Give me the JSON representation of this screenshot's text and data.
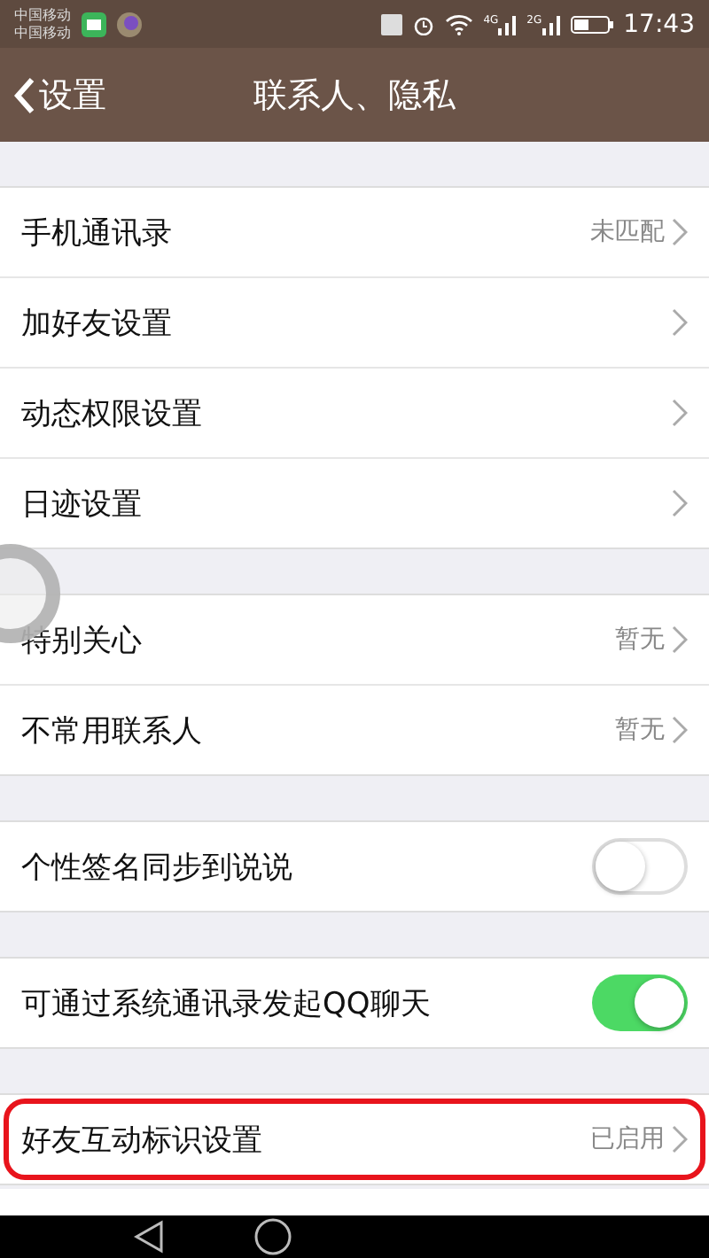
{
  "status_bar": {
    "carriers": [
      "中国移动",
      "中国移动"
    ],
    "time": "17:43",
    "network_labels": [
      "4G",
      "2G"
    ]
  },
  "header": {
    "back": "设置",
    "title": "联系人、隐私"
  },
  "groups": [
    {
      "rows": [
        {
          "kind": "value",
          "label": "手机通讯录",
          "value": "未匹配",
          "highlighted": false
        },
        {
          "kind": "link",
          "label": "加好友设置",
          "highlighted": false
        },
        {
          "kind": "link",
          "label": "动态权限设置",
          "highlighted": false
        },
        {
          "kind": "link",
          "label": "日迹设置",
          "highlighted": false
        }
      ]
    },
    {
      "rows": [
        {
          "kind": "value",
          "label": "特别关心",
          "value": "暂无",
          "highlighted": false
        },
        {
          "kind": "value",
          "label": "不常用联系人",
          "value": "暂无",
          "highlighted": false
        }
      ]
    },
    {
      "rows": [
        {
          "kind": "toggle",
          "label": "个性签名同步到说说",
          "on": false,
          "highlighted": false
        }
      ]
    },
    {
      "rows": [
        {
          "kind": "toggle",
          "label": "可通过系统通讯录发起QQ聊天",
          "on": true,
          "highlighted": false
        }
      ]
    },
    {
      "rows": [
        {
          "kind": "value",
          "label": "好友互动标识设置",
          "value": "已启用",
          "highlighted": true
        }
      ]
    }
  ]
}
